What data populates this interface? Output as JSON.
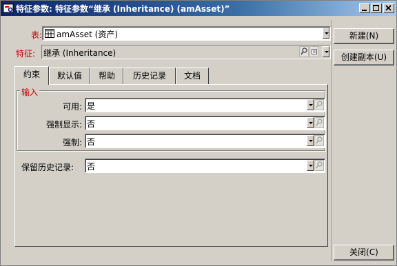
{
  "window": {
    "title": "特征参数: 特征参数“继承 (Inheritance) (amAsset)”",
    "minimize_glyph": "_",
    "maximize_glyph": "□",
    "close_glyph": "✕"
  },
  "header": {
    "table_label": "表:",
    "table_value": "amAsset (资产)",
    "feature_label": "特征:",
    "feature_value": "继承 (Inheritance)"
  },
  "tabs": [
    {
      "label": "约束",
      "active": true
    },
    {
      "label": "默认值",
      "active": false
    },
    {
      "label": "帮助",
      "active": false
    },
    {
      "label": "历史记录",
      "active": false
    },
    {
      "label": "文档",
      "active": false
    }
  ],
  "input_group": {
    "legend": "输入",
    "fields": [
      {
        "label": "可用:",
        "value": "是"
      },
      {
        "label": "强制显示:",
        "value": "否"
      },
      {
        "label": "强制:",
        "value": "否"
      }
    ]
  },
  "history_field": {
    "label": "保留历史记录:",
    "value": "否"
  },
  "buttons": {
    "new": "新建(N)",
    "duplicate": "创建副本(U)",
    "close": "关闭(C)"
  },
  "colors": {
    "title_start": "#0a246a",
    "title_end": "#a6caf0",
    "face": "#d4d0c8",
    "required_label": "#c00000"
  }
}
